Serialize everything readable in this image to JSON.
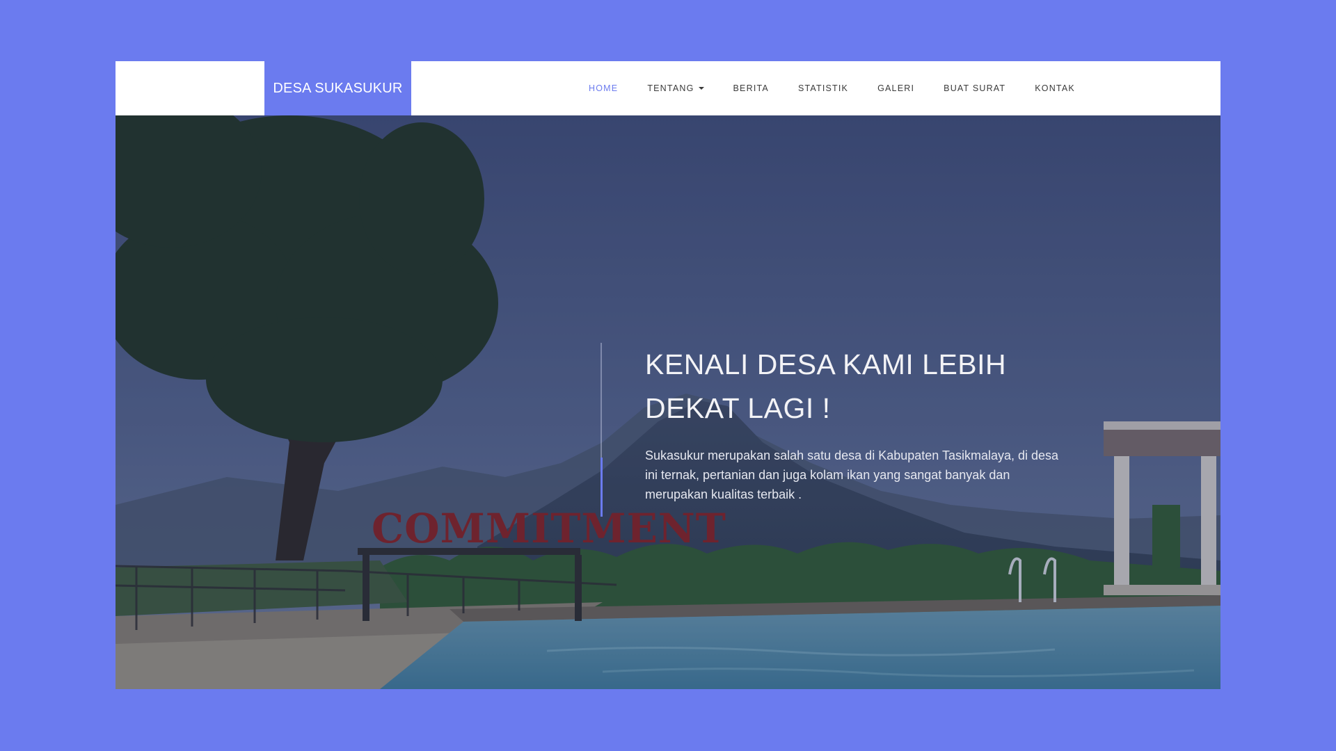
{
  "brand": {
    "name": "DESA SUKASUKUR",
    "color": "#6b7bef"
  },
  "nav": {
    "items": [
      {
        "label": "HOME",
        "active": true
      },
      {
        "label": "TENTANG",
        "has_dropdown": true
      },
      {
        "label": "BERITA"
      },
      {
        "label": "STATISTIK"
      },
      {
        "label": "GALERI"
      },
      {
        "label": "BUAT SURAT"
      },
      {
        "label": "KONTAK"
      }
    ]
  },
  "hero": {
    "title_line1": "KENALI DESA KAMI LEBIH",
    "title_line2": "DEKAT LAGI !",
    "description": "Sukasukur merupakan salah satu desa di Kabupaten Tasikmalaya, di desa ini ternak, pertanian dan juga kolam ikan yang sangat banyak dan merupakan kualitas terbaik .",
    "sign_text": "COMMITMENT",
    "accent_color": "#6b7bef"
  }
}
